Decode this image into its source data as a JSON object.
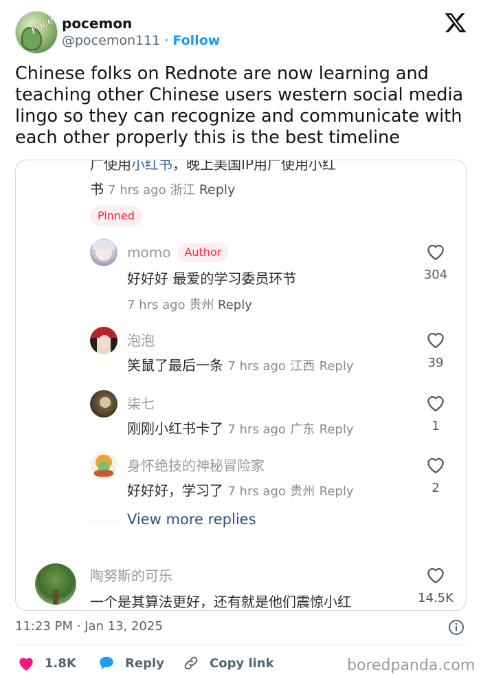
{
  "tweet": {
    "display_name": "pocemon",
    "handle": "@pocemon111",
    "separator": "·",
    "follow_label": "Follow",
    "avatar_text": "Poce",
    "text": "Chinese folks on Rednote are now learning and teaching other Chinese users western social media lingo so they can recognize and communicate with each other properly this is the best timeline",
    "timestamp": "11:23 PM · Jan 13, 2025",
    "actions": {
      "like_count": "1.8K",
      "reply_label": "Reply",
      "copy_label": "Copy link"
    }
  },
  "screenshot": {
    "clipped_top_line_a": "广使用",
    "clipped_top_line_link": "小红书",
    "clipped_top_line_b": "，晚上美国IP用广使用小红",
    "first_comment_tail": "书",
    "first_comment_meta_time": "7 hrs ago",
    "first_comment_meta_loc": "浙江",
    "reply_label": "Reply",
    "pinned_label": "Pinned",
    "author_label": "Author",
    "comments": [
      {
        "name": "momo",
        "text": "好好好 最爱的学习委员环节",
        "time": "7 hrs ago",
        "loc": "贵州",
        "likes": "304",
        "avatar": "momo-avatar"
      },
      {
        "name": "泡泡",
        "text": "笑鼠了最后一条",
        "time": "7 hrs ago",
        "loc": "江西",
        "likes": "39",
        "avatar": "paopao-avatar"
      },
      {
        "name": "柒七",
        "text": "刚刚小红书卡了",
        "time": "7 hrs ago",
        "loc": "广东",
        "likes": "1",
        "avatar": "qiqi-avatar"
      },
      {
        "name": "身怀绝技的神秘冒险家",
        "text": "好好好，学习了",
        "time": "7 hrs ago",
        "loc": "贵州",
        "likes": "2",
        "avatar": "adventurer-avatar"
      }
    ],
    "view_more_label": "View more replies",
    "last_comment": {
      "name": "陶努斯的可乐",
      "text_clipped": "一个是其算法更好，还有就是他们震惊小红",
      "likes": "14.5K"
    }
  },
  "watermark": "boredpanda.com",
  "colors": {
    "follow_blue": "#1d9bf0",
    "like_pink": "#f91880",
    "reply_blue": "#1d9bf0",
    "xhs_red": "#ff2442",
    "view_more_blue": "#2e4f7d"
  }
}
